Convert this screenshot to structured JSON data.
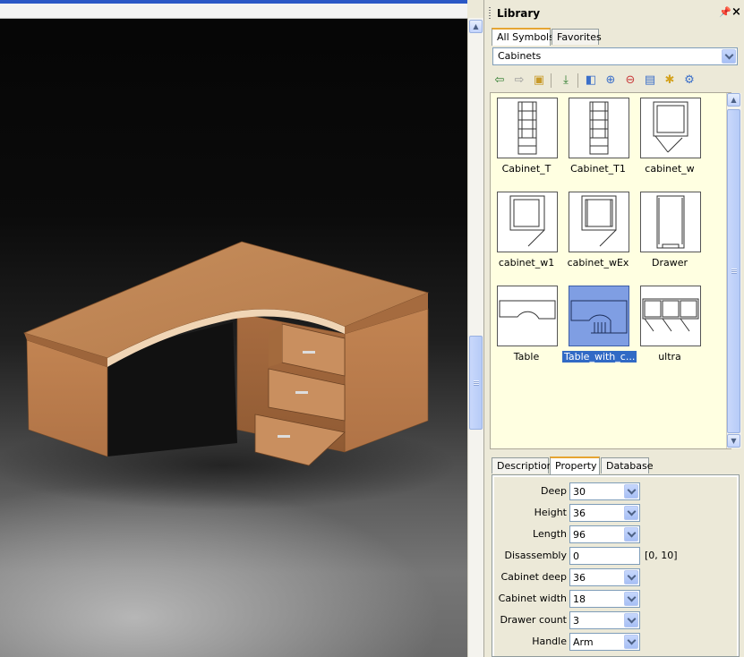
{
  "library": {
    "title": "Library",
    "tabs": [
      {
        "label": "All Symbols",
        "active": true
      },
      {
        "label": "Favorites",
        "active": false
      }
    ],
    "category": "Cabinets",
    "toolbar_icons": [
      "back-arrow-icon",
      "forward-arrow-icon",
      "folder-home-icon",
      "import-icon",
      "add-folder-icon",
      "add-symbol-icon",
      "remove-symbol-icon",
      "lock-symbol-icon",
      "star-symbol-icon",
      "settings-symbol-icon"
    ],
    "symbols": [
      {
        "label": "Cabinet_T",
        "selected": false
      },
      {
        "label": "Cabinet_T1",
        "selected": false
      },
      {
        "label": "cabinet_w",
        "selected": false
      },
      {
        "label": "cabinet_w1",
        "selected": false
      },
      {
        "label": "cabinet_wEx",
        "selected": false
      },
      {
        "label": "Drawer",
        "selected": false
      },
      {
        "label": "Table",
        "selected": false
      },
      {
        "label": "Table_with_c...",
        "selected": true
      },
      {
        "label": "ultra",
        "selected": false
      }
    ]
  },
  "details": {
    "tabs": [
      {
        "label": "Description",
        "active": false
      },
      {
        "label": "Property",
        "active": true
      },
      {
        "label": "Database",
        "active": false
      }
    ],
    "properties": [
      {
        "label": "Deep",
        "value": "30",
        "dropdown": true
      },
      {
        "label": "Height",
        "value": "36",
        "dropdown": true
      },
      {
        "label": "Length",
        "value": "96",
        "dropdown": true
      },
      {
        "label": "Disassembly",
        "value": "0",
        "dropdown": false,
        "range": "[0, 10]"
      },
      {
        "label": "Cabinet deep",
        "value": "36",
        "dropdown": true
      },
      {
        "label": "Cabinet width",
        "value": "18",
        "dropdown": true
      },
      {
        "label": "Drawer count",
        "value": "3",
        "dropdown": true
      },
      {
        "label": "Handle",
        "value": "Arm",
        "dropdown": true
      }
    ]
  },
  "colors": {
    "selection": "#316ac5",
    "panel": "#ece9d8",
    "grid_bg": "#ffffe1",
    "wood": "#c58a5a"
  }
}
